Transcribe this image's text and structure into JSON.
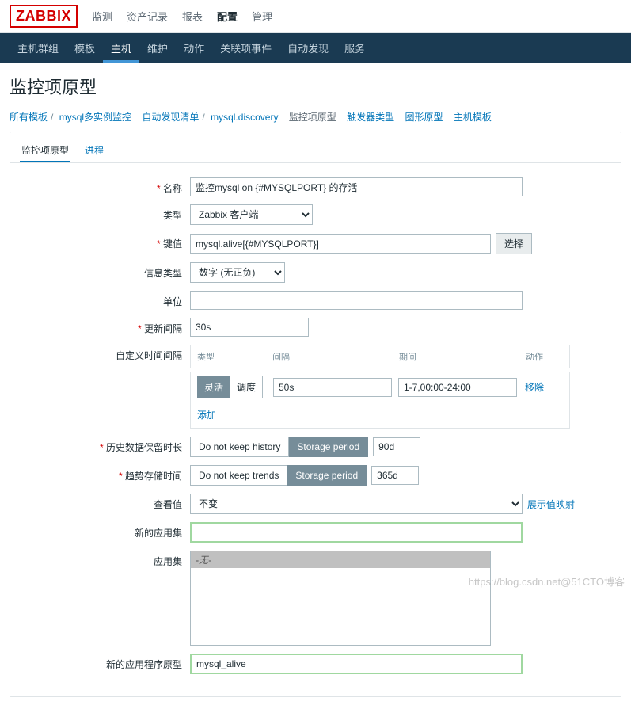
{
  "logo": "ZABBIX",
  "topnav": {
    "items": [
      {
        "label": "监测"
      },
      {
        "label": "资产记录"
      },
      {
        "label": "报表"
      },
      {
        "label": "配置",
        "active": true
      },
      {
        "label": "管理"
      }
    ]
  },
  "subnav": {
    "items": [
      {
        "label": "主机群组"
      },
      {
        "label": "模板"
      },
      {
        "label": "主机",
        "active": true
      },
      {
        "label": "维护"
      },
      {
        "label": "动作"
      },
      {
        "label": "关联项事件"
      },
      {
        "label": "自动发现"
      },
      {
        "label": "服务"
      }
    ]
  },
  "page_title": "监控项原型",
  "breadcrumb": {
    "items": [
      {
        "label": "所有模板",
        "link": true
      },
      {
        "label": "mysql多实例监控",
        "link": true
      },
      {
        "label": "自动发现清单",
        "link": true
      },
      {
        "label": "mysql.discovery",
        "link": true
      },
      {
        "label": "监控项原型",
        "current": true
      },
      {
        "label": "触发器类型",
        "link": true
      },
      {
        "label": "图形原型",
        "link": true
      },
      {
        "label": "主机模板",
        "link": true
      }
    ]
  },
  "panel_tabs": {
    "items": [
      {
        "label": "监控项原型",
        "active": true
      },
      {
        "label": "进程"
      }
    ]
  },
  "form": {
    "name": {
      "label": "名称",
      "value": "监控mysql on {#MYSQLPORT} 的存活"
    },
    "type": {
      "label": "类型",
      "value": "Zabbix 客户端"
    },
    "key": {
      "label": "键值",
      "value": "mysql.alive[{#MYSQLPORT}]",
      "select_btn": "选择"
    },
    "info_type": {
      "label": "信息类型",
      "value": "数字 (无正负)"
    },
    "units": {
      "label": "单位",
      "value": ""
    },
    "update_interval": {
      "label": "更新间隔",
      "value": "30s"
    },
    "custom_intervals": {
      "label": "自定义时间间隔",
      "head_type": "类型",
      "head_interval": "间隔",
      "head_period": "期间",
      "head_action": "动作",
      "toggle_flex": "灵活",
      "toggle_sched": "调度",
      "interval_val": "50s",
      "period_val": "1-7,00:00-24:00",
      "remove": "移除",
      "add": "添加"
    },
    "history": {
      "label": "历史数据保留时长",
      "btn1": "Do not keep history",
      "btn2": "Storage period",
      "value": "90d"
    },
    "trends": {
      "label": "趋势存储时间",
      "btn1": "Do not keep trends",
      "btn2": "Storage period",
      "value": "365d"
    },
    "show_value": {
      "label": "查看值",
      "value": "不变",
      "show_map": "展示值映射"
    },
    "new_app": {
      "label": "新的应用集",
      "value": ""
    },
    "apps": {
      "label": "应用集",
      "none": "-无-"
    },
    "new_app_proto": {
      "label": "新的应用程序原型",
      "value": "mysql_alive"
    }
  },
  "watermark": "https://blog.csdn.net@51CTO博客"
}
